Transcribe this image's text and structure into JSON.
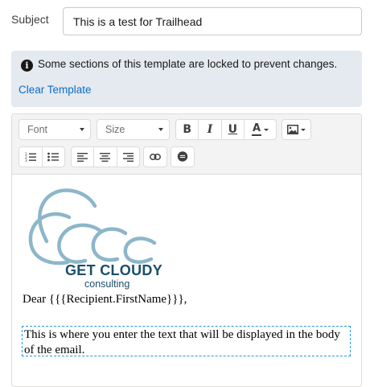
{
  "subject": {
    "label": "Subject",
    "value": "This is a test for Trailhead"
  },
  "notice": {
    "message": "Some sections of this template are locked to prevent changes.",
    "clear_link": "Clear Template",
    "icon": "info-icon"
  },
  "toolbar": {
    "font_label": "Font",
    "size_label": "Size",
    "bold": "B",
    "italic": "I",
    "underline": "U",
    "text_color": "A",
    "text_color_swatch": "#3e3e3c",
    "icons": [
      "bold-icon",
      "italic-icon",
      "underline-icon",
      "text-color-icon",
      "image-icon",
      "numbered-list-icon",
      "bulleted-list-icon",
      "align-left-icon",
      "align-center-icon",
      "align-right-icon",
      "link-icon",
      "merge-field-icon"
    ]
  },
  "email_body": {
    "logo": {
      "line1": "GET CLOUDY",
      "line2": "consulting",
      "color_text": "#1b4f6a",
      "color_swirl": "#8db6c9"
    },
    "greeting": "Dear {{{Recipient.FirstName}}},",
    "editable_text": "This is where you enter the text that will be displayed in the body of the email."
  }
}
